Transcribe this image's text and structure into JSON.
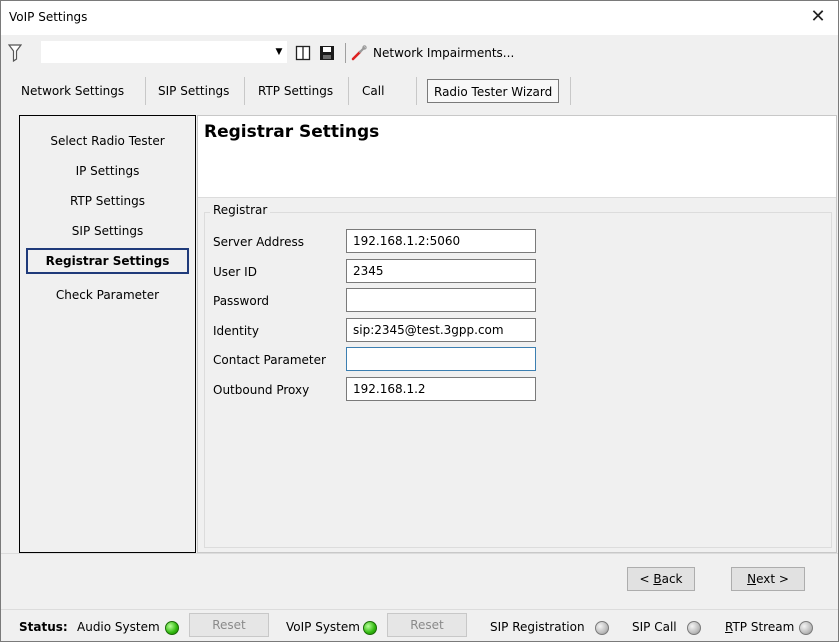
{
  "window": {
    "title": "VoIP Settings",
    "close_glyph": "✕"
  },
  "toolbar": {
    "filter_icon": "filter-icon",
    "combo_value": "",
    "combo_arrow": "▼",
    "impairments_label": "Network Impairments..."
  },
  "tabs": [
    {
      "label": "Network Settings"
    },
    {
      "label": "SIP Settings"
    },
    {
      "label": "RTP Settings"
    },
    {
      "label": "Call"
    },
    {
      "label": "Radio Tester Wizard",
      "active": true
    }
  ],
  "nav": {
    "items": [
      {
        "label": "Select Radio Tester"
      },
      {
        "label": "IP Settings"
      },
      {
        "label": "RTP Settings"
      },
      {
        "label": "SIP Settings"
      },
      {
        "label": "Registrar Settings",
        "selected": true
      },
      {
        "label": "Check Parameter"
      }
    ]
  },
  "panel": {
    "title": "Registrar Settings",
    "group_label": "Registrar",
    "fields": [
      {
        "label": "Server Address",
        "value": "192.168.1.2:5060"
      },
      {
        "label": "User ID",
        "value": "2345"
      },
      {
        "label": "Password",
        "value": ""
      },
      {
        "label": "Identity",
        "value": "sip:2345@test.3gpp.com"
      },
      {
        "label": "Contact Parameter",
        "value": ""
      },
      {
        "label": "Outbound Proxy",
        "value": "192.168.1.2"
      }
    ]
  },
  "buttons": {
    "back_prefix": "< ",
    "back_mnemonic": "B",
    "back_rest": "ack",
    "next_mnemonic": "N",
    "next_rest": "ext >"
  },
  "status": {
    "label": "Status:",
    "audio_system": "Audio System",
    "voip_system": "VoIP System",
    "reset_label": "Reset",
    "sip_registration": "SIP Registration",
    "sip_call": "SIP Call",
    "rtp_stream_mnemonic": "R",
    "rtp_stream_rest": "TP Stream",
    "colors": {
      "ok": "#2fb80d",
      "idle": "#bdbdbd"
    }
  }
}
